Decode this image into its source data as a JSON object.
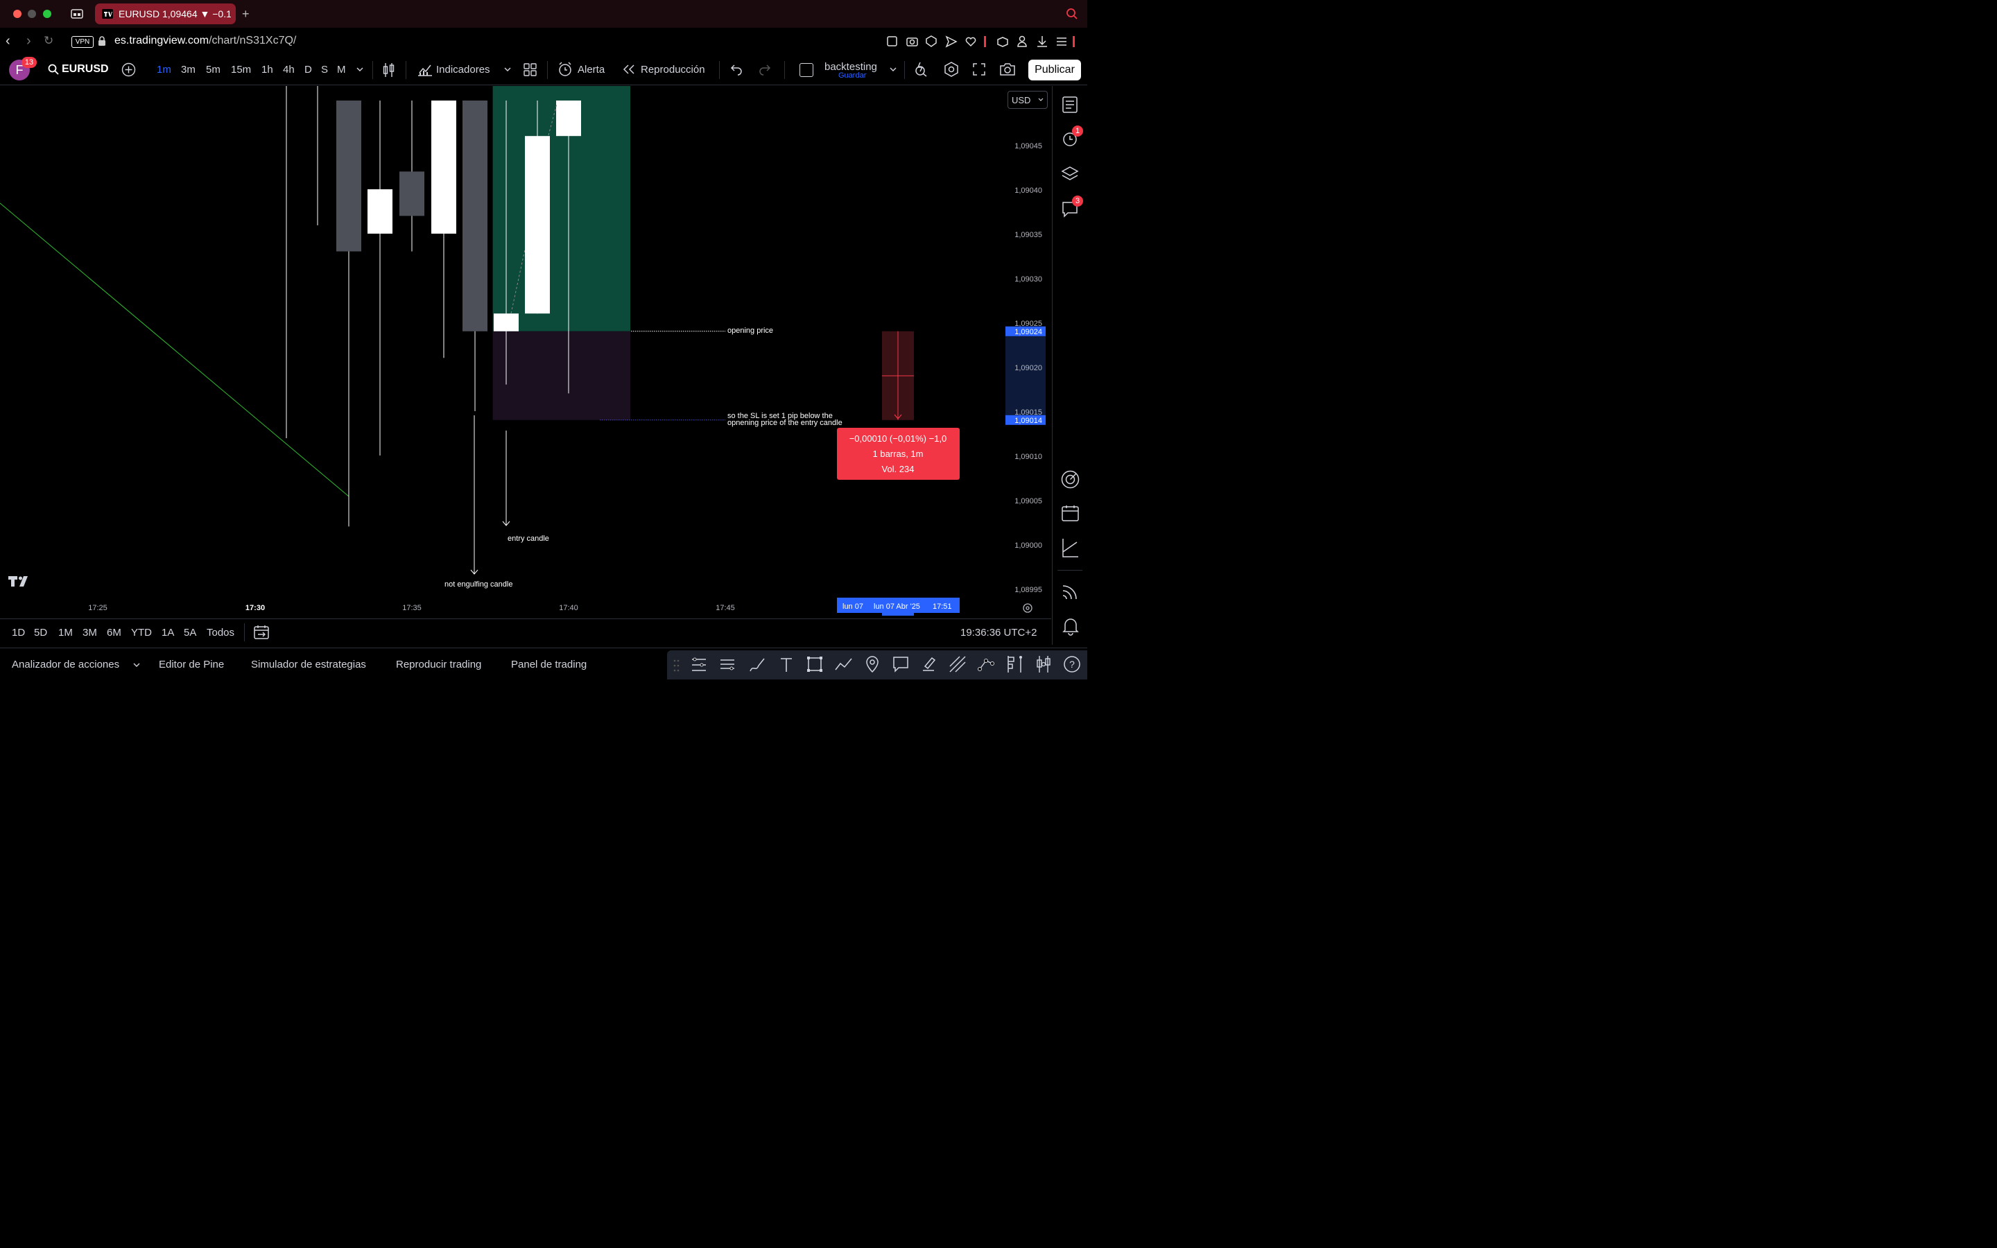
{
  "browser": {
    "tab_title": "EURUSD 1,09464 ▼ −0.17",
    "vpn_label": "VPN",
    "url_domain": "es.tradingview.com",
    "url_path": "/chart/nS31Xc7Q/"
  },
  "toolbar": {
    "avatar_letter": "F",
    "avatar_badge": "13",
    "symbol": "EURUSD",
    "timeframes": [
      "1m",
      "3m",
      "5m",
      "15m",
      "1h",
      "4h",
      "D",
      "S",
      "M"
    ],
    "active_timeframe": "1m",
    "indicators_label": "Indicadores",
    "alert_label": "Alerta",
    "replay_label": "Reproducción",
    "layout_name": "backtesting",
    "layout_save": "Guardar",
    "publish_label": "Publicar",
    "currency": "USD"
  },
  "chart_data": {
    "type": "candlestick",
    "instrument": "EURUSD",
    "interval": "1m",
    "x_ticks": [
      "17:25",
      "17:30",
      "17:35",
      "17:40",
      "17:45"
    ],
    "y_ticks": [
      "1,09045",
      "1,09040",
      "1,09035",
      "1,09030",
      "1,09025",
      "1,09020",
      "1,09015",
      "1,09010",
      "1,09005",
      "1,09000",
      "1,08995"
    ],
    "price_labels": [
      {
        "value": "1,09024",
        "color": "#2962ff"
      },
      {
        "value": "1,09014",
        "color": "#2962ff"
      }
    ],
    "candles": [
      {
        "time": "17:32",
        "open": 1.0904,
        "close": 1.09035,
        "high": 1.0905,
        "low": 1.09035,
        "color": "bear"
      },
      {
        "time": "17:33",
        "open": 1.09033,
        "close": 1.0905,
        "high": 1.0905,
        "low": 1.09002,
        "color": "bear"
      },
      {
        "time": "17:34",
        "open": 1.09035,
        "close": 1.0904,
        "high": 1.0905,
        "low": 1.0901,
        "color": "bull"
      },
      {
        "time": "17:35",
        "open": 1.09042,
        "close": 1.09037,
        "high": 1.0905,
        "low": 1.09033,
        "color": "bear"
      },
      {
        "time": "17:36",
        "open": 1.09035,
        "close": 1.0905,
        "high": 1.0905,
        "low": 1.09021,
        "color": "bull"
      },
      {
        "time": "17:37",
        "open": 1.0905,
        "close": 1.09024,
        "high": 1.0905,
        "low": 1.09015,
        "color": "bear"
      },
      {
        "time": "17:38",
        "open": 1.09024,
        "close": 1.09026,
        "high": 1.0905,
        "low": 1.09018,
        "color": "bull"
      },
      {
        "time": "17:39",
        "open": 1.09026,
        "close": 1.09046,
        "high": 1.0905,
        "low": 1.09026,
        "color": "bull"
      },
      {
        "time": "17:40",
        "open": 1.09046,
        "close": 1.0905,
        "high": 1.0905,
        "low": 1.09017,
        "color": "bull"
      }
    ],
    "position": {
      "entry": 1.09024,
      "stop": 1.09014,
      "target_above": true
    },
    "annotations": [
      "opening price",
      "so the SL is set 1 pip below the",
      "opnening price of the entry candle",
      "entry candle",
      "not engulfing candle"
    ],
    "measure_tooltip": {
      "line1": "−0,00010 (−0,01%) −1,0",
      "line2": "1 barras, 1m",
      "line3": "Vol. 234"
    },
    "crosshair_time": {
      "left": "lun 07",
      "main": "lun 07 Abr '25",
      "time": "17:51"
    }
  },
  "rangebar": {
    "ranges": [
      "1D",
      "5D",
      "1M",
      "3M",
      "6M",
      "YTD",
      "1A",
      "5A",
      "Todos"
    ],
    "clock": "19:36:36 UTC+2"
  },
  "bottom_tabs": [
    "Analizador de acciones",
    "Editor de Pine",
    "Simulador de estrategias",
    "Reproducir trading",
    "Panel de trading"
  ],
  "sidebar_badges": {
    "alerts": "1",
    "chat": "3"
  },
  "colors": {
    "bull": "#ffffff",
    "bear": "#4e5059",
    "profit_zone": "#0c4a3a",
    "loss_zone": "#1a1020",
    "accent_blue": "#2962ff",
    "alert_red": "#f23645",
    "trendline": "#2ebd2e"
  }
}
